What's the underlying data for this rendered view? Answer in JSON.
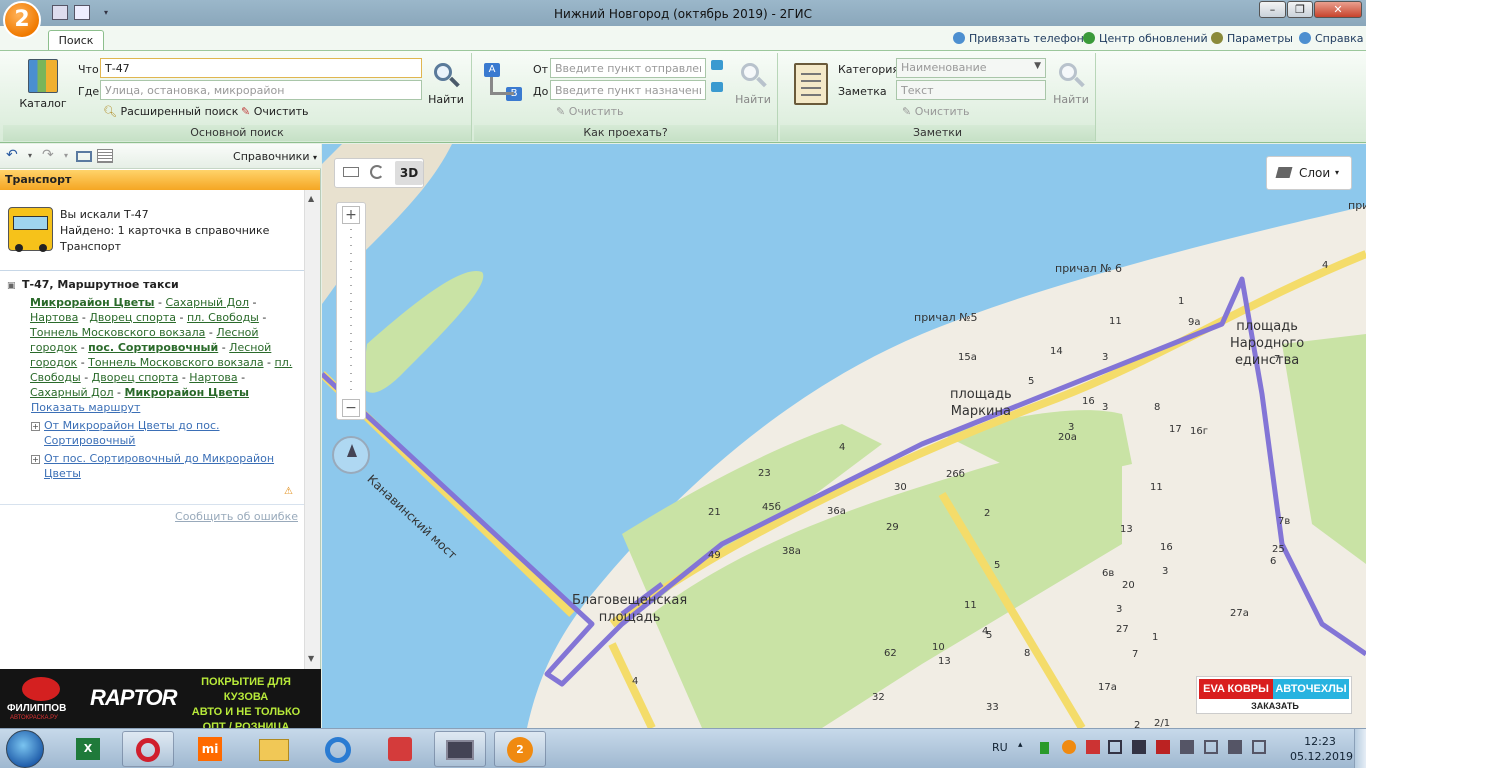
{
  "window": {
    "title": "Нижний Новгород (октябрь 2019) - 2ГИС",
    "logo": "2",
    "minimize_glyph": "–",
    "maximize_glyph": "❐",
    "close_glyph": "✕"
  },
  "ribbon": {
    "active_tab": "Поиск",
    "top_links": [
      "Привязать телефон",
      "Центр обновлений",
      "Параметры",
      "Справка"
    ],
    "main_search": {
      "catalog_label": "Каталог",
      "what_label": "Что",
      "what_value": "Т-47",
      "where_label": "Где",
      "where_placeholder": "Улица, остановка, микрорайон",
      "find_label": "Найти",
      "advanced_label": "Расширенный поиск",
      "clear_label": "Очистить",
      "group_label": "Основной поиск"
    },
    "route": {
      "from_label": "От",
      "from_placeholder": "Введите пункт отправления",
      "to_label": "До",
      "to_placeholder": "Введите пункт назначения",
      "find_label": "Найти",
      "clear_label": "Очистить",
      "group_label": "Как проехать?"
    },
    "notes": {
      "category_label": "Категория",
      "category_placeholder": "Наименование",
      "note_label": "Заметка",
      "note_placeholder": "Текст",
      "find_label": "Найти",
      "clear_label": "Очистить",
      "group_label": "Заметки"
    }
  },
  "left_panel": {
    "directory_label": "Справочники",
    "header": "Транспорт",
    "search_info": {
      "query": "Вы искали Т-47",
      "found": "Найдено: 1 карточка в справочнике",
      "category": "Транспорт"
    },
    "route_title": "Т-47, Маршрутное такси",
    "stops_forward": [
      "Микрорайон Цветы",
      "Сахарный Дол",
      "Нартова",
      "Дворец спорта",
      "пл. Свободы",
      "Тоннель Московского вокзала",
      "Лесной городок",
      "пос. Сортировочный"
    ],
    "stops_back": [
      "Лесной городок",
      "Тоннель Московского вокзала",
      "пл. Свободы",
      "Дворец спорта",
      "Нартова",
      "Сахарный Дол",
      "Микрорайон Цветы"
    ],
    "show_route": "Показать маршрут",
    "direction_1": "От Микрорайон Цветы до пос. Сортировочный",
    "direction_2": "От пос. Сортировочный до Микрорайон Цветы",
    "report_error": "Сообщить об ошибке"
  },
  "ad_banner": {
    "brand1": "ФИЛИППОВ",
    "brand1_sub": "АВТОКРАСКА.РУ",
    "brand2": "RAPTOR",
    "line1": "ПОКРЫТИЕ ДЛЯ КУЗОВА",
    "line2": "АВТО И НЕ ТОЛЬКО",
    "line3": "ОПТ / РОЗНИЦА"
  },
  "map": {
    "mode_3d": "3D",
    "layers_label": "Слои",
    "zoom_in": "+",
    "zoom_out": "−",
    "bridge_label": "Канавинский мост",
    "places": {
      "square_marks": "площадь\nМаркина",
      "square_unity": "площадь\nНародного\nединства",
      "square_blag": "Благовещенская\nплощадь",
      "pier5": "причал №5",
      "pier6": "причал № 6",
      "pier_cut": "прич"
    },
    "house_numbers": [
      "4",
      "9а",
      "11",
      "1",
      "3",
      "7",
      "14",
      "3",
      "15а",
      "5",
      "8",
      "16",
      "17",
      "16г",
      "4",
      "20а",
      "23",
      "26б",
      "30",
      "21",
      "45б",
      "36а",
      "29",
      "49",
      "38а",
      "2",
      "5",
      "13",
      "3",
      "16",
      "11",
      "6в",
      "20",
      "27",
      "27а",
      "25",
      "10",
      "4",
      "62",
      "13",
      "8",
      "33",
      "32",
      "17а",
      "2",
      "2/1",
      "7в",
      "6",
      "4",
      "11",
      "5",
      "1",
      "3",
      "7",
      "3"
    ],
    "ad": {
      "part1": "EVA КОВРЫ",
      "part2": "АВТОЧЕХЛЫ",
      "action": "ЗАКАЗАТЬ"
    },
    "colors": {
      "water": "#8dc8ec",
      "park": "#c9e3a5",
      "route": "#8375d6",
      "road_yellow": "#f4dc6a",
      "ground": "#f1ede4"
    }
  },
  "taskbar": {
    "lang": "RU",
    "time": "12:23",
    "date": "05.12.2019",
    "apps": [
      "start-orb",
      "excel-icon",
      "opera-icon",
      "xiaomi-icon",
      "folder-icon",
      "ie-icon",
      "kingsoft-icon",
      "monitor-icon",
      "2gis-icon"
    ],
    "xiaomi_text": "mi"
  }
}
